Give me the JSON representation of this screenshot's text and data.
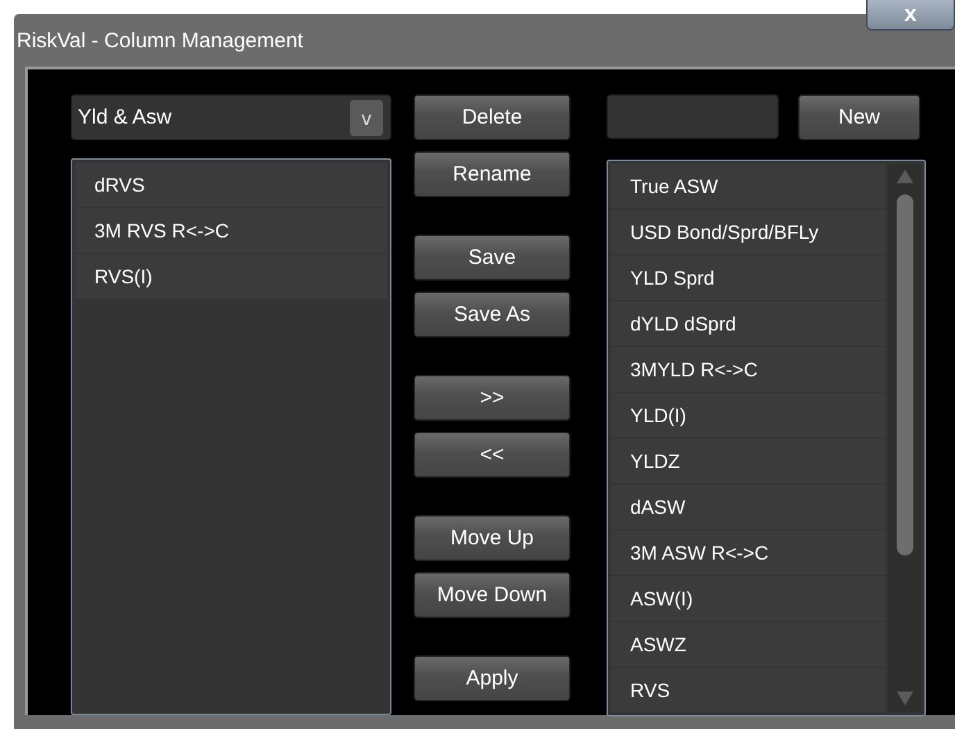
{
  "window": {
    "title": "RiskVal - Column Management",
    "close": "x"
  },
  "left": {
    "dropdown": {
      "value": "Yld & Asw",
      "caret": "v"
    },
    "items": [
      "dRVS",
      "3M RVS R<->C",
      "RVS(I)"
    ]
  },
  "button_groups": [
    [
      "Delete",
      "Rename"
    ],
    [
      "Save",
      "Save As"
    ],
    [
      ">>",
      "<<"
    ],
    [
      "Move Up",
      "Move Down"
    ],
    [
      "Apply"
    ]
  ],
  "right": {
    "new_button": "New",
    "items": [
      "True ASW",
      "USD Bond/Sprd/BFLy",
      "YLD Sprd",
      "dYLD dSprd",
      "3MYLD R<->C",
      "YLD(I)",
      "YLDZ",
      "dASW",
      "3M ASW R<->C",
      "ASW(I)",
      "ASWZ",
      "RVS"
    ]
  }
}
